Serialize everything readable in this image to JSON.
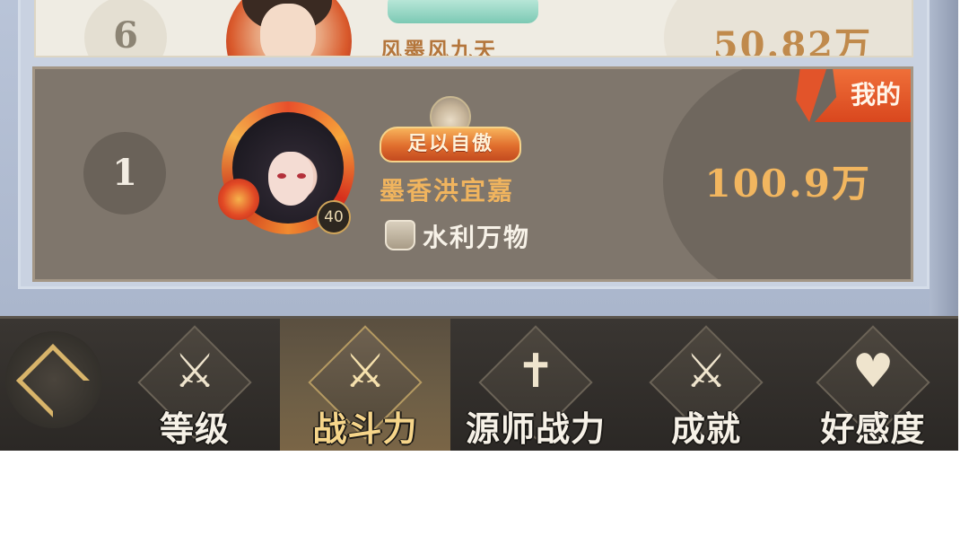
{
  "leaderboard": {
    "row_prev": {
      "rank": "6",
      "name": "风墨风九天",
      "score": "50.82万"
    },
    "my_row": {
      "rank": "1",
      "level": "40",
      "title_badge_text": "足以自傲",
      "name": "墨香洪宜嘉",
      "guild": "水利万物",
      "score": "100.9万",
      "mine_tag": "我的"
    }
  },
  "tabbar": {
    "back_icon": "back-arrow-icon",
    "tabs": [
      {
        "label": "等级",
        "icon": "sword-leaf-icon",
        "active": false
      },
      {
        "label": "战斗力",
        "icon": "crossed-swords-icon",
        "active": true
      },
      {
        "label": "源师战力",
        "icon": "sword-cross-icon",
        "active": false
      },
      {
        "label": "成就",
        "icon": "sword-leaf-icon",
        "active": false
      },
      {
        "label": "好感度",
        "icon": "heart-emblem-icon",
        "active": false
      }
    ]
  },
  "colors": {
    "my_row_bg": "#7f766c",
    "score_gold": "#f2b65f",
    "mine_tag": "#e2542a",
    "tab_active_text": "#f6d58a"
  }
}
